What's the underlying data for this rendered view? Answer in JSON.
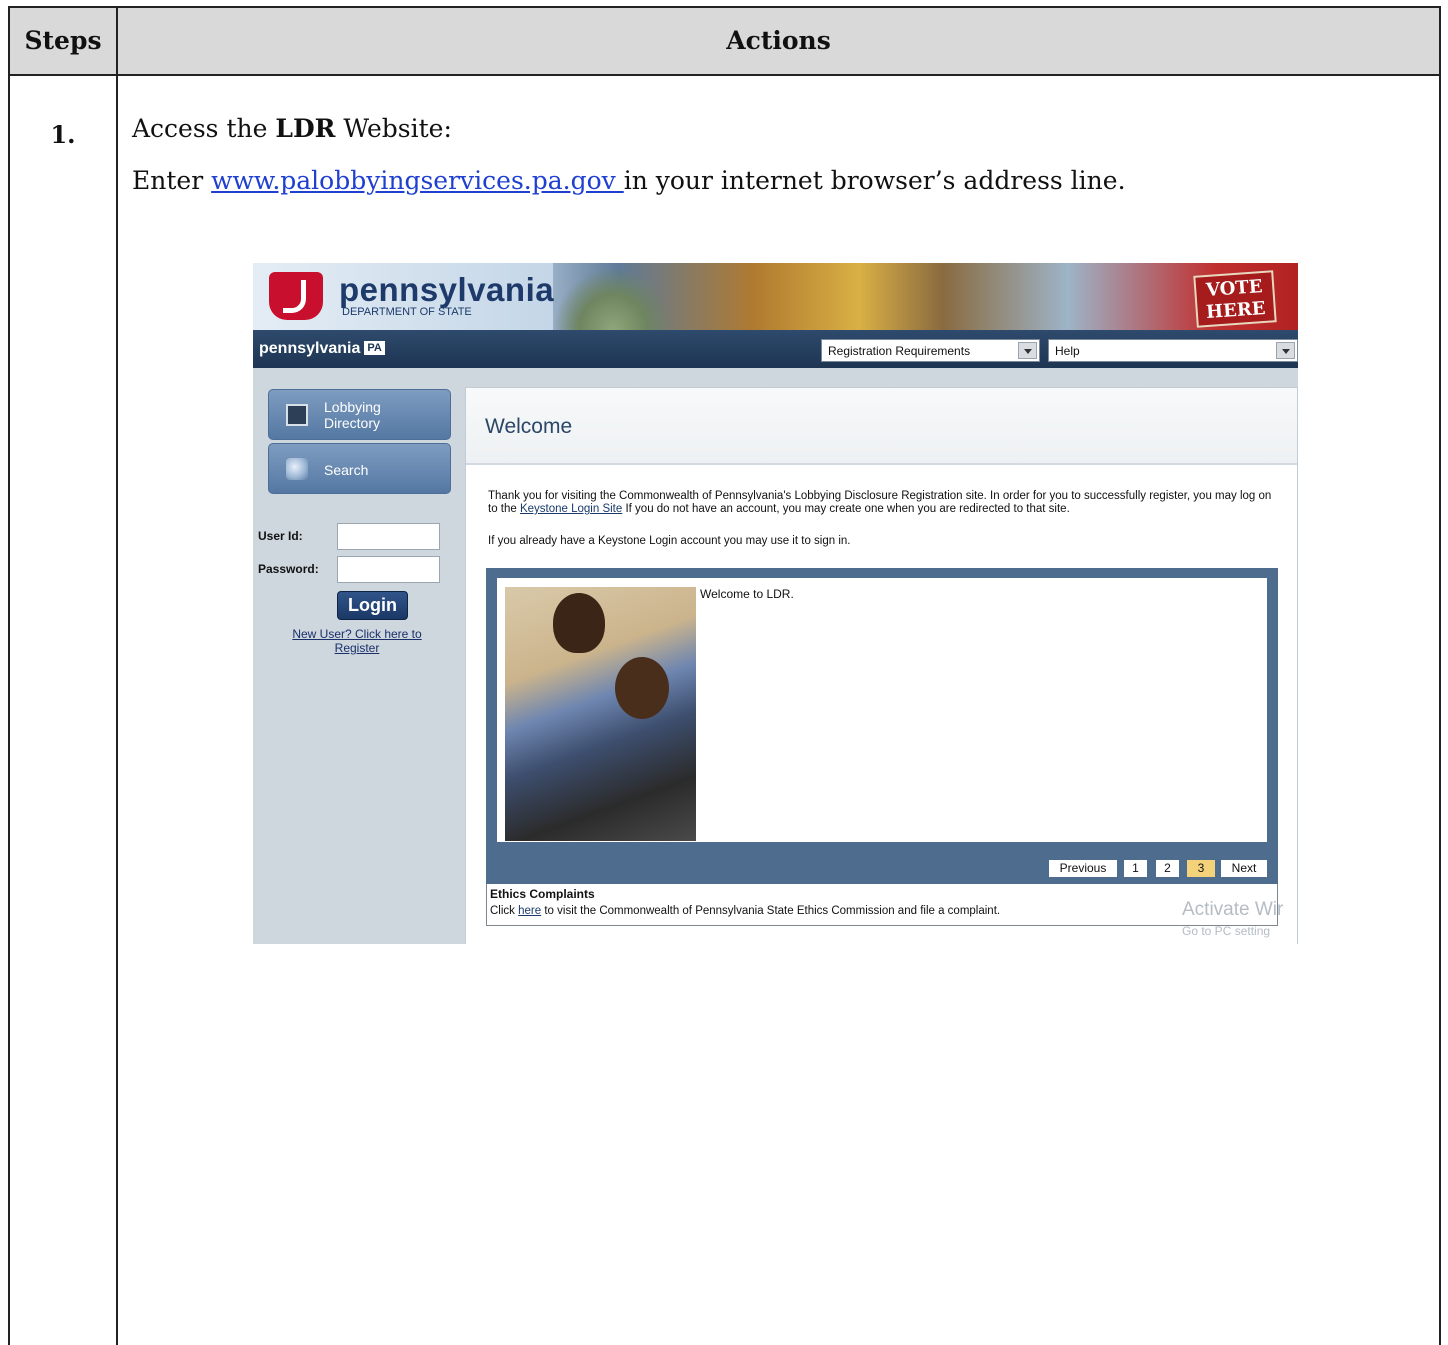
{
  "table": {
    "header_steps": "Steps",
    "header_actions": "Actions"
  },
  "step1": {
    "number": "1.",
    "line1_prefix": "Access the ",
    "line1_bold": "LDR",
    "line1_suffix": " Website:",
    "line2_prefix": "Enter ",
    "line2_link": "www.palobbyingservices.pa.gov ",
    "line2_suffix": "in your internet browser’s address line."
  },
  "site": {
    "logo_title": "pennsylvania",
    "logo_subtitle": "DEPARTMENT OF STATE",
    "nav_brand": "pennsylvania",
    "nav_badge": "PA",
    "vote_sign": "VOTE HERE",
    "select_registration": "Registration Requirements",
    "select_help": "Help",
    "side_lobbying": "Lobbying Directory",
    "side_search": "Search",
    "user_id_label": "User Id:",
    "password_label": "Password:",
    "login_button": "Login",
    "register_link": "New User? Click here to Register",
    "welcome_title": "Welcome",
    "intro_part1": "Thank you for visiting the Commonwealth of Pennsylvania's Lobbying Disclosure Registration site. In order for you to successfully register, you may log on to the ",
    "intro_link": "Keystone Login Site",
    "intro_part2": " If you do not have an account, you may create one when you are redirected to that site.",
    "intro_line2": "If you already have a Keystone Login account you may use it to sign in.",
    "slide_caption": "Welcome to LDR.",
    "pager": [
      "Previous",
      "1",
      "2",
      "3",
      "Next"
    ],
    "pager_active": "3",
    "ethics_title": "Ethics Complaints",
    "ethics_prefix": "Click ",
    "ethics_link": "here",
    "ethics_suffix": "  to visit the Commonwealth of Pennsylvania State Ethics Commission and file a complaint.",
    "watermark_line1": "Activate Wir",
    "watermark_line2": "Go to PC setting"
  }
}
